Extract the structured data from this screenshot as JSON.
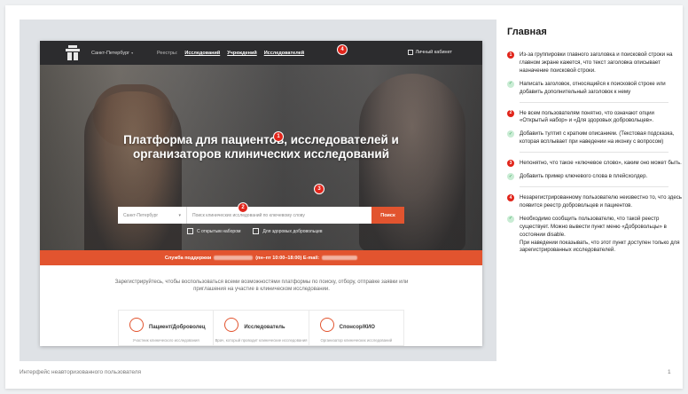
{
  "page": {
    "caption": "Интерфейс неавторизованного пользователя",
    "page_number": "1"
  },
  "site": {
    "header": {
      "city": "Санкт-Петербург",
      "registries_label": "Реестры:",
      "registries": [
        "Исследований",
        "Учреждений",
        "Исследователей"
      ],
      "cabinet": "Личный кабинет"
    },
    "hero": {
      "title_line1": "Платформа для пациентов, исследователей и",
      "title_line2": "организаторов клинических исследований",
      "search_city": "Санкт-Петербург",
      "search_placeholder": "Поиск клинических исследований по ключевому слову",
      "search_button": "Поиск",
      "check_open": "С открытым набором",
      "check_volunteers": "Для здоровых добровольцев"
    },
    "support": {
      "label": "Служба поддержки",
      "hours": "(пн–пт 10:00–18:00) E-mail:"
    },
    "register_text": "Зарегистрируйтесь, чтобы воспользоваться всеми возможностями платформы по поиску, отбору, отправке заявки или приглашения на участие в клиническом исследовании.",
    "cards": [
      {
        "title": "Пациент/Доброволец",
        "subtitle": "Участник клинического исследования"
      },
      {
        "title": "Исследователь",
        "subtitle": "Врач, который проводит клинические исследования"
      },
      {
        "title": "Спонсор/КИО",
        "subtitle": "Организатор клинических исследований"
      }
    ],
    "markers": [
      "1",
      "2",
      "3",
      "4"
    ]
  },
  "panel": {
    "title": "Главная",
    "groups": [
      {
        "problem_num": "1",
        "problem": "Из-за группировки главного заголовка и поисковой строки на главном экране кажется, что текст заголовка описывает назначение поисковой строки.",
        "fix": "Написать заголовок, относящийся к поисковой строке или добавить дополнительный заголовок к нему"
      },
      {
        "problem_num": "2",
        "problem": "Не всем пользователям понятно, что означают опции «Открытый набор» и «Для здоровых добровольцев».",
        "fix": "Добавить тултип с кратким описанием. (Текстовая подсказка, которая всплывает при наведении на иконку с вопросом)"
      },
      {
        "problem_num": "3",
        "problem": "Непонятно, что такое «ключевое слово», каким оно может быть.",
        "fix": "Добавить пример ключевого слова в плейсхолдер."
      },
      {
        "problem_num": "4",
        "problem": "Незарегистрированному пользователю неизвестно то, что здесь появится реестр добровольцев и пациентов.",
        "fix": "Необходимо сообщить пользователю, что такой реестр существует. Можно вывести пункт меню «Добровольцы» в состоянии disable.\nПри наведении показывать, что этот пункт доступен только для зарегистрированных исследователей."
      }
    ],
    "fix_icon": "check-icon",
    "colors": {
      "problem": "#e1251b",
      "fix": "#c9ecd4",
      "accent": "#e2542f"
    }
  }
}
